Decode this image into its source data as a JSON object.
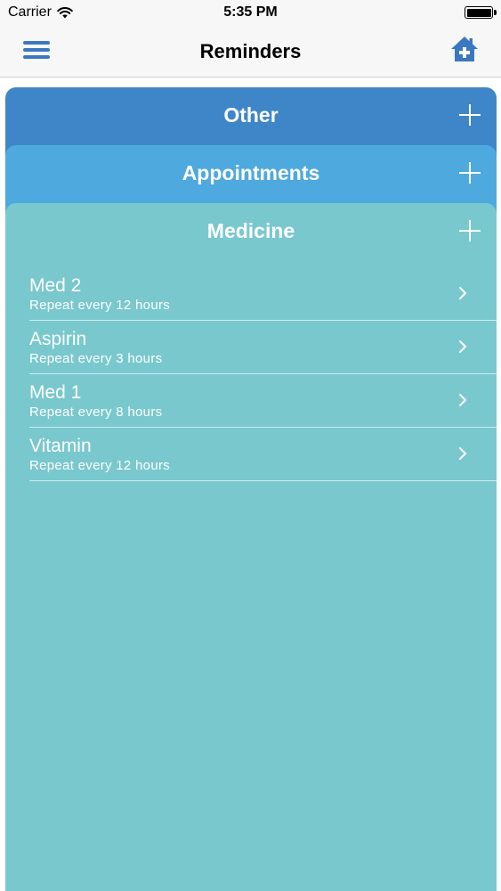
{
  "status_bar": {
    "carrier": "Carrier",
    "time": "5:35 PM",
    "wifi_icon": "wifi-icon",
    "battery_icon": "battery-icon"
  },
  "nav": {
    "title": "Reminders",
    "menu_icon": "hamburger-menu-icon",
    "home_icon": "home-plus-icon"
  },
  "sections": {
    "other": {
      "title": "Other",
      "color": "#3f86c9"
    },
    "appointments": {
      "title": "Appointments",
      "color": "#4ea9de"
    },
    "medicine": {
      "title": "Medicine",
      "color": "#79c8ce",
      "items": [
        {
          "name": "Med 2",
          "detail": "Repeat every 12 hours"
        },
        {
          "name": "Aspirin",
          "detail": "Repeat every 3 hours"
        },
        {
          "name": "Med 1",
          "detail": "Repeat every 8 hours"
        },
        {
          "name": "Vitamin",
          "detail": "Repeat every 12 hours"
        }
      ]
    }
  },
  "colors": {
    "accent": "#3a78bf",
    "text_on_card": "#ffffff"
  }
}
